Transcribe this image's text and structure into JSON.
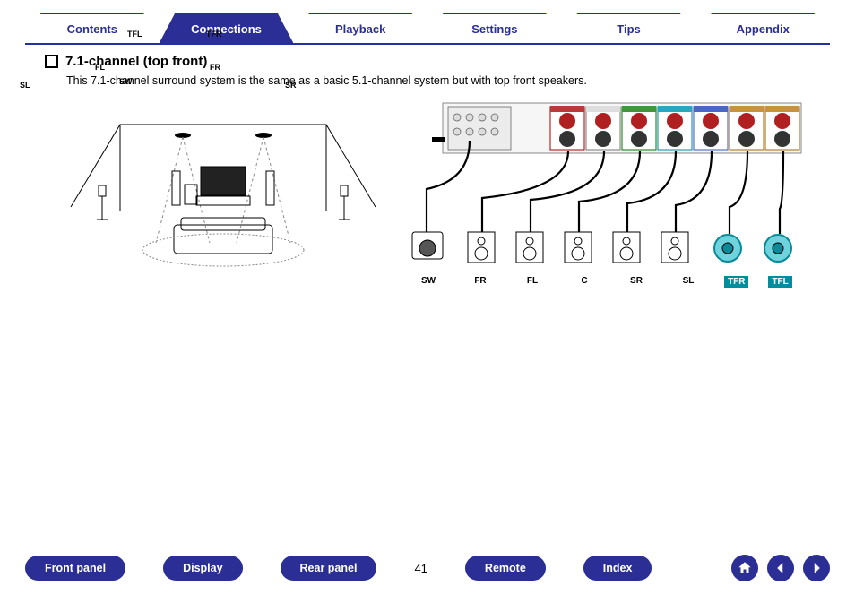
{
  "tabs": {
    "items": [
      "Contents",
      "Connections",
      "Playback",
      "Settings",
      "Tips",
      "Appendix"
    ],
    "active": 1
  },
  "section": {
    "title": "7.1-channel (top front)",
    "body": "This 7.1-channel surround system is the same as a basic 5.1-channel system but with top front speakers."
  },
  "room_labels": {
    "tfl": "TFL",
    "tfr": "TFR",
    "fl": "FL",
    "fr": "FR",
    "sl": "SL",
    "sr": "SR",
    "sw": "SW"
  },
  "conn_labels": [
    "SW",
    "FR",
    "FL",
    "C",
    "SR",
    "SL",
    "TFR",
    "TFL"
  ],
  "bottom_nav": {
    "items": [
      "Front panel",
      "Display",
      "Rear panel"
    ],
    "items2": [
      "Remote",
      "Index"
    ],
    "page": "41"
  },
  "icons": {
    "home": "home-icon",
    "prev": "arrow-left-icon",
    "next": "arrow-right-icon"
  }
}
